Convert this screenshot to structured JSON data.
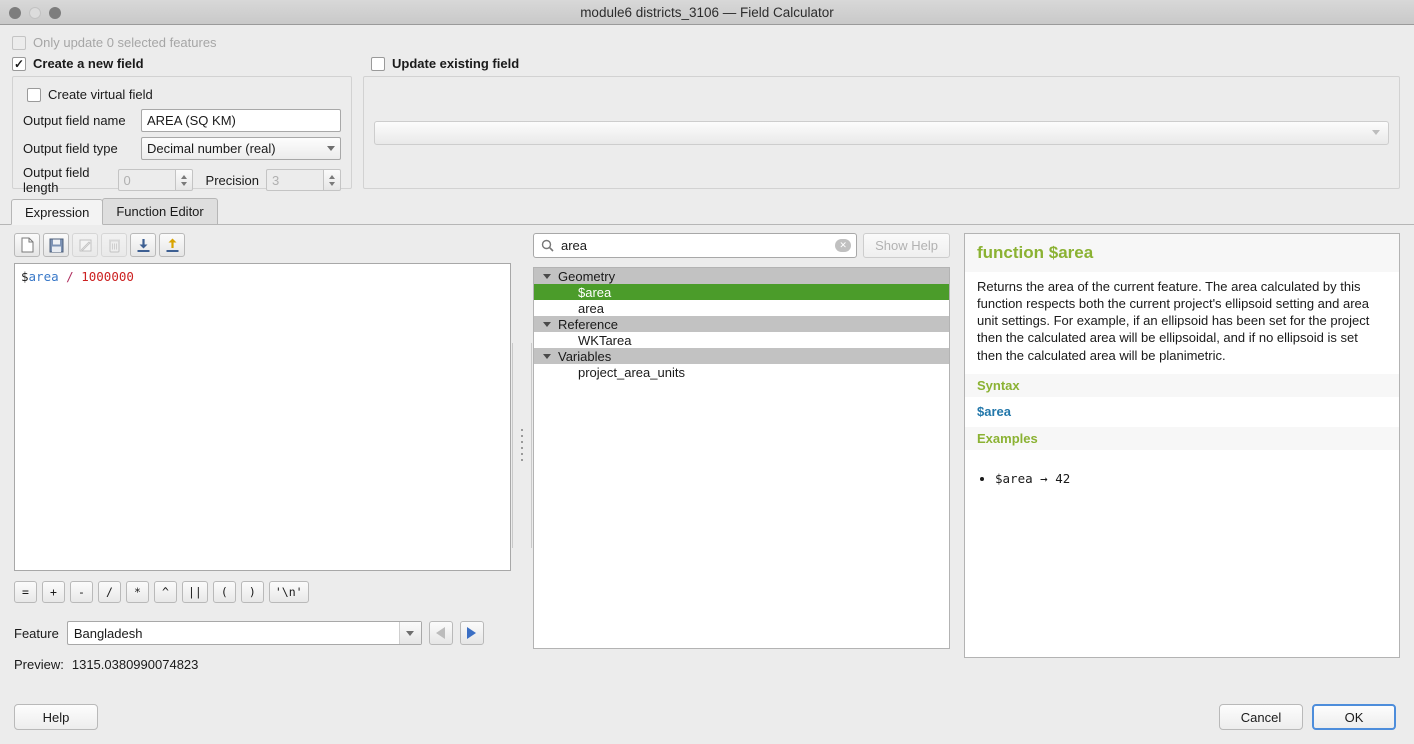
{
  "window": {
    "title": "module6 districts_3106 — Field Calculator",
    "controls": {
      "close": "close-button",
      "minimize": "minimize-button",
      "maximize": "maximize-button"
    }
  },
  "options": {
    "only_update_selected": {
      "label": "Only update 0 selected features",
      "checked": false,
      "enabled": false,
      "mark": ""
    },
    "create_new_field": {
      "label": "Create a new field",
      "checked": true,
      "mark": "✓"
    },
    "update_existing_field": {
      "label": "Update existing field",
      "checked": false,
      "mark": ""
    },
    "create_virtual_field": {
      "label": "Create virtual field",
      "checked": false,
      "mark": ""
    }
  },
  "new_field_form": {
    "name_label": "Output field name",
    "name_value": "AREA (SQ KM)",
    "type_label": "Output field type",
    "type_value": "Decimal number (real)",
    "length_label": "Output field length",
    "length_value": "0",
    "precision_label": "Precision",
    "precision_value": "3"
  },
  "existing_field": {
    "selected_value": ""
  },
  "tabs": [
    {
      "label": "Expression",
      "active": true
    },
    {
      "label": "Function Editor",
      "active": false
    }
  ],
  "expression_toolbar": [
    {
      "icon": "new-file-icon",
      "enabled": true
    },
    {
      "icon": "save-icon",
      "enabled": true
    },
    {
      "icon": "edit-icon",
      "enabled": false
    },
    {
      "icon": "delete-icon",
      "enabled": false
    },
    {
      "icon": "import-icon",
      "enabled": true
    },
    {
      "icon": "export-icon",
      "enabled": true
    }
  ],
  "expression": {
    "full_text": "$area / 1000000",
    "tokens": {
      "dollar": "$",
      "function": "area",
      "operator": "/",
      "number": "1000000"
    }
  },
  "operators": [
    "=",
    "+",
    "-",
    "/",
    "*",
    "^",
    "||",
    "(",
    ")",
    "'\\n'"
  ],
  "feature": {
    "label": "Feature",
    "value": "Bangladesh",
    "prev_enabled": false,
    "next_enabled": true
  },
  "preview": {
    "label": "Preview:",
    "value": "1315.0380990074823"
  },
  "search": {
    "value": "area",
    "placeholder": "Search",
    "clear_glyph": "✕",
    "show_help_label": "Show Help",
    "show_help_enabled": false
  },
  "function_tree": [
    {
      "type": "group",
      "label": "Geometry",
      "expanded": true
    },
    {
      "type": "item",
      "label": "$area",
      "selected": true
    },
    {
      "type": "item",
      "label": "area",
      "selected": false
    },
    {
      "type": "group",
      "label": "Reference",
      "expanded": true
    },
    {
      "type": "item",
      "label": "WKTarea",
      "selected": false
    },
    {
      "type": "group",
      "label": "Variables",
      "expanded": true
    },
    {
      "type": "item",
      "label": "project_area_units",
      "selected": false
    }
  ],
  "help": {
    "title": "function $area",
    "description": "Returns the area of the current feature. The area calculated by this function respects both the current project's ellipsoid setting and area unit settings. For example, if an ellipsoid has been set for the project then the calculated area will be ellipsoidal, and if no ellipsoid is set then the calculated area will be planimetric.",
    "syntax_heading": "Syntax",
    "syntax_code": "$area",
    "examples_heading": "Examples",
    "examples": [
      "$area → 42"
    ]
  },
  "footer": {
    "help_label": "Help",
    "cancel_label": "Cancel",
    "ok_label": "OK"
  },
  "colors": {
    "selection_green": "#4b9c2a",
    "help_heading_green": "#8bb233",
    "syntax_blue": "#2277aa",
    "focus_blue": "#4d8ddb"
  }
}
